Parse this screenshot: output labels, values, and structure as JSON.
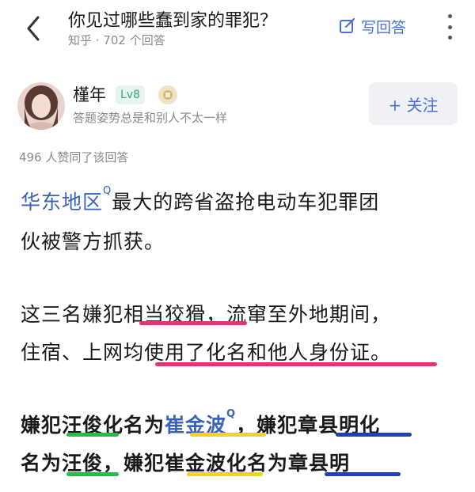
{
  "header": {
    "title": "你见过哪些蠢到家的罪犯？",
    "subtitle": "知乎 · 702 个回答",
    "write_answer": "写回答"
  },
  "author": {
    "name": "槿年",
    "level": "Lv8",
    "description": "答题姿势总是和别人不太一样",
    "follow_label": "+ 关注"
  },
  "likes_text": "496 人赞同了该回答",
  "content": {
    "p1_link": "华东地区",
    "p1_line1_rest": "最大的跨省盗抢电动车犯罪团",
    "p1_line2": "伙被警方抓获。",
    "p2_line1": "这三名嫌犯相当狡猾，流窜至外地期间，",
    "p2_line2": "住宿、上网均使用了化名和他人身份证。",
    "p3_line1_a": "嫌犯汪俊化名为",
    "p3_line1_link": "崔金波",
    "p3_line1_b": "，嫌犯章县明化",
    "p3_line2": "名为汪俊，嫌犯崔金波化名为章县明",
    "search_marker": "Q"
  },
  "colors": {
    "accent_blue": "#4a6fd9",
    "underline_pink": "#e6356e",
    "underline_green": "#2fb84a",
    "underline_yellow": "#f0d41e",
    "underline_navy": "#2140b8"
  }
}
